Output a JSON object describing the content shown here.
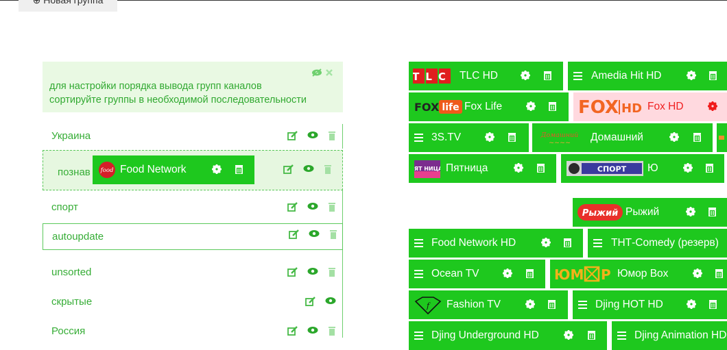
{
  "toolbar": {
    "new_group_label": "⊕ Новая группа"
  },
  "info": {
    "line1": "для настройки порядка вывода групп каналов",
    "line2": "сортируйте группы в необходимой последовательности"
  },
  "groups": [
    {
      "label": "Украина"
    },
    {
      "label": "познав"
    },
    {
      "label": "спорт"
    },
    {
      "label": "autoupdate"
    },
    {
      "label": "unsorted"
    },
    {
      "label": "скрытые"
    },
    {
      "label": "Россия"
    }
  ],
  "dragging_channel": {
    "name": "Food Network"
  },
  "channels": [
    {
      "name": "TLC HD"
    },
    {
      "name": "Amedia Hit HD"
    },
    {
      "name": "Fox Life"
    },
    {
      "name": "Fox HD"
    },
    {
      "name": "3S.TV"
    },
    {
      "name": "Домашний"
    },
    {
      "name": "Пятница"
    },
    {
      "name": "Ю"
    },
    {
      "name": "Рыжий"
    },
    {
      "name": "Food Network HD"
    },
    {
      "name": "ТНТ-Comedy (резерв)"
    },
    {
      "name": "Ocean TV"
    },
    {
      "name": "Юмор Box"
    },
    {
      "name": "Fashion TV"
    },
    {
      "name": "Djing HOT HD"
    },
    {
      "name": "Djing Underground HD"
    },
    {
      "name": "Djing Animation HD"
    }
  ],
  "logos": {
    "tlc": "TLC",
    "fox": "FOX",
    "life": "life",
    "foxhd_fox": "FOX",
    "foxhd_hd": "HD",
    "domashniy": "Домашний",
    "pyatnitsa": "ПЯТ НИЦА!",
    "sport": "СПОРТ",
    "ryzhiy": "Рыжий",
    "humor_a": "ЮМ",
    "humor_b": "Р",
    "food": "food"
  },
  "colors": {
    "accent": "#1ec81e",
    "text": "#36ad36",
    "pink": "#ffd9df"
  }
}
